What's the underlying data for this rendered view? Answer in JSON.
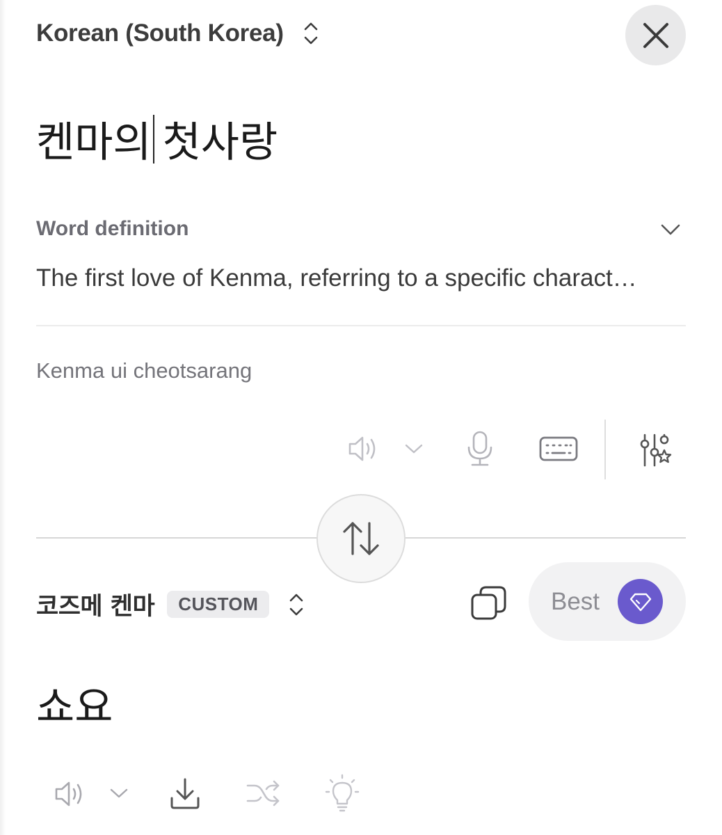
{
  "source": {
    "language_label": "Korean (South Korea)",
    "text_before_caret": "켄마의",
    "text_after_caret": "첫사랑",
    "definition_title": "Word definition",
    "definition_text": "The first love of Kenma, referring to a specific charact…",
    "transliteration": "Kenma ui cheotsarang"
  },
  "target": {
    "language_label": "코즈메 켄마",
    "badge": "CUSTOM",
    "best_label": "Best",
    "text": "쇼요"
  },
  "colors": {
    "accent": "#6a5acd",
    "icon": "#7a7a80",
    "icon_light": "#b4b4ba"
  }
}
